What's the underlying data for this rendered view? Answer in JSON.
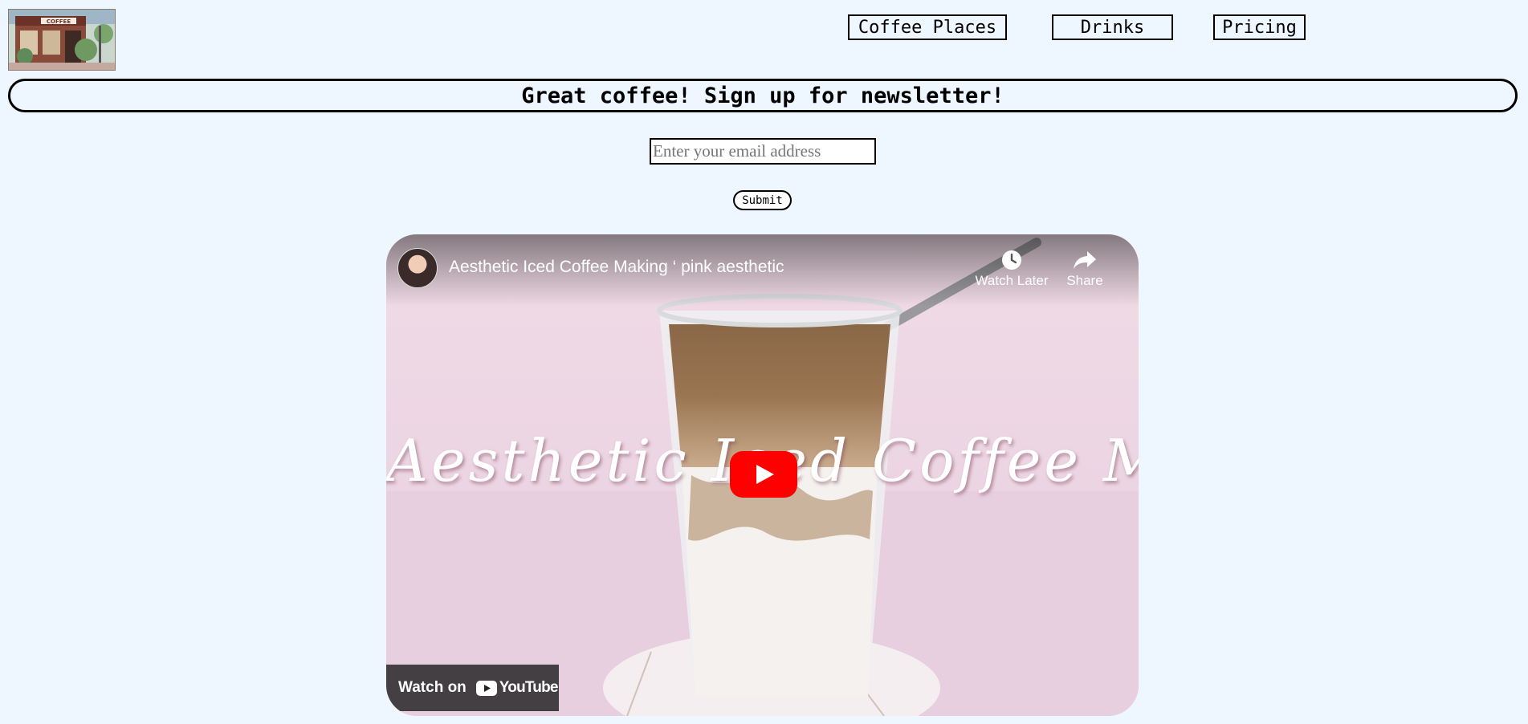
{
  "logo": {
    "sign_text": "COFFEE"
  },
  "nav": {
    "items": [
      {
        "label": "Coffee Places"
      },
      {
        "label": "Drinks"
      },
      {
        "label": "Pricing"
      }
    ]
  },
  "newsletter": {
    "headline": "Great coffee! Sign up for newsletter!",
    "email_placeholder": "Enter your email address",
    "submit_label": "Submit"
  },
  "video": {
    "title": "Aesthetic Iced Coffee Making ‘ pink aesthetic",
    "overlay_text": "Aesthetic Iced Coffee Making",
    "watch_later_label": "Watch Later",
    "share_label": "Share",
    "watch_on_label": "Watch on",
    "youtube_label": "YouTube",
    "colors": {
      "play_red": "#ff0000",
      "background_pink": "#f3dce9"
    }
  },
  "colors": {
    "page_background": "#eef6ff"
  }
}
